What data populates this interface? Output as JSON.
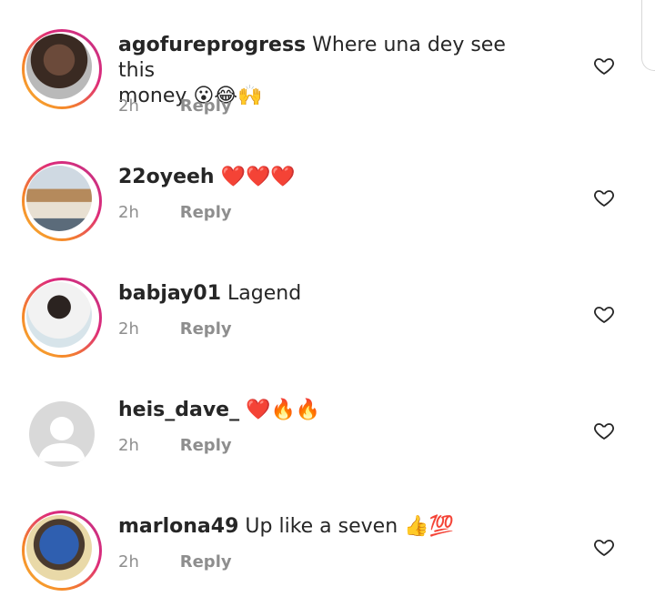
{
  "comments": [
    {
      "username": "agofureprogress",
      "text": "Where una dey see this",
      "text2": "money 😮😂🙌",
      "time": "2h",
      "reply_label": "Reply",
      "avatar": "ringed-photo-man"
    },
    {
      "username": "22oyeeh",
      "text": "❤️❤️❤️",
      "time": "2h",
      "reply_label": "Reply",
      "avatar": "ringed-photo-city"
    },
    {
      "username": "babjay01",
      "text": "Lagend",
      "time": "2h",
      "reply_label": "Reply",
      "avatar": "ringed-photo-man-cap"
    },
    {
      "username": "heis_dave_",
      "text": "❤️🔥🔥",
      "time": "2h",
      "reply_label": "Reply",
      "avatar": "default-gray"
    },
    {
      "username": "marlona49",
      "text": "Up like a seven 👍💯",
      "time": "2h",
      "reply_label": "Reply",
      "avatar": "ringed-photo-blue-shirt"
    }
  ],
  "icons": {
    "like": "heart-outline-icon"
  },
  "colors": {
    "text": "#262626",
    "meta": "#8e8e8e",
    "ring_start": "#f7b733",
    "ring_end": "#c13584"
  }
}
